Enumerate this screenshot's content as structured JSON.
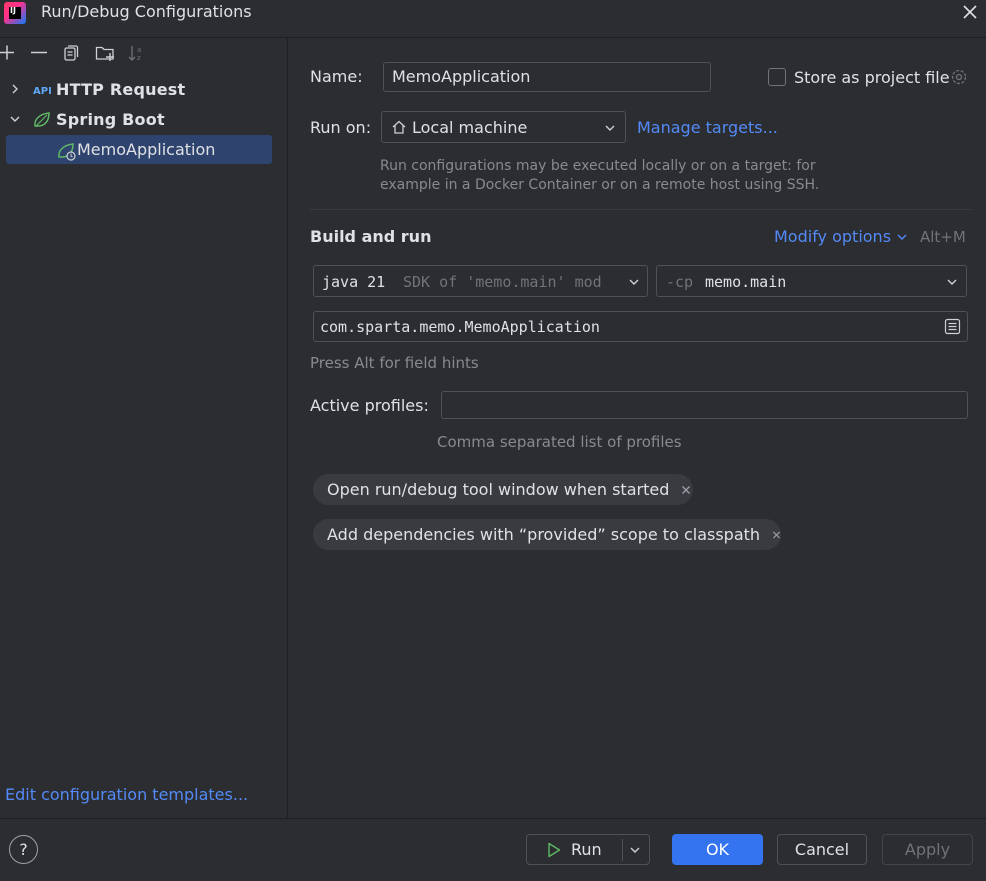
{
  "window": {
    "title": "Run/Debug Configurations",
    "logo_text": "IJ"
  },
  "tree": {
    "items": [
      {
        "label": "HTTP Request",
        "expanded": false
      },
      {
        "label": "Spring Boot",
        "expanded": true
      },
      {
        "label": "MemoApplication",
        "selected": true
      }
    ],
    "edit_templates_link": "Edit configuration templates..."
  },
  "form": {
    "name_label": "Name:",
    "name_value": "MemoApplication",
    "store_label": "Store as project file",
    "store_checked": false,
    "run_on_label": "Run on:",
    "run_on_value": "Local machine",
    "manage_targets": "Manage targets...",
    "run_on_hint_1": "Run configurations may be executed locally or on a target: for",
    "run_on_hint_2": "example in a Docker Container or on a remote host using SSH.",
    "section_title": "Build and run",
    "modify_options": "Modify options",
    "modify_shortcut": "Alt+M",
    "jdk_main": "java 21",
    "jdk_detail": "SDK of 'memo.main' mod",
    "cp_flag": "-cp",
    "cp_value": "memo.main",
    "main_class": "com.sparta.memo.MemoApplication",
    "field_hint": "Press Alt for field hints",
    "profiles_label": "Active profiles:",
    "profiles_value": "",
    "profiles_hint": "Comma separated list of profiles",
    "chips": [
      "Open run/debug tool window when started",
      "Add dependencies with “provided” scope to classpath"
    ]
  },
  "buttons": {
    "help": "?",
    "run": "Run",
    "ok": "OK",
    "cancel": "Cancel",
    "apply": "Apply"
  },
  "colors": {
    "accent": "#3574f0",
    "link": "#548af7",
    "background": "#2b2d30",
    "selection": "#2e436e",
    "spring_green": "#5fb865"
  }
}
